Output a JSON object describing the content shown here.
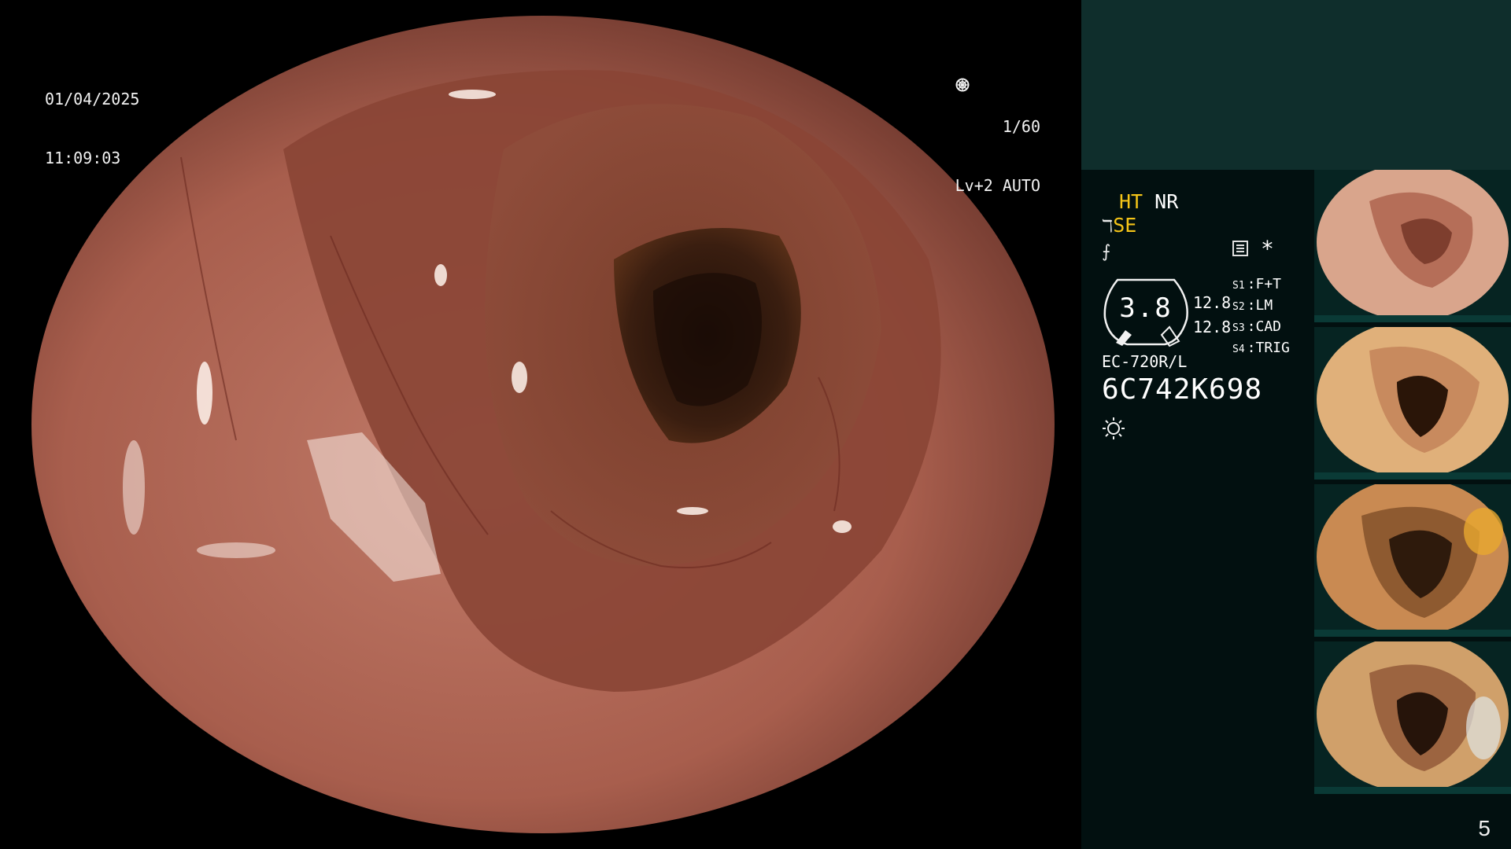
{
  "osd": {
    "date": "01/04/2025",
    "time": "11:09:03",
    "shutter": "1/60",
    "level": "Lv+2 AUTO"
  },
  "status": {
    "ht": "HT",
    "nr": "NR",
    "se": "SE",
    "zoom": "3.8",
    "enh_a": "12.8",
    "enh_b": "12.8",
    "modes": [
      {
        "key": "S1",
        "label": "F+T"
      },
      {
        "key": "S2",
        "label": "LM"
      },
      {
        "key": "S3",
        "label": "CAD"
      },
      {
        "key": "S4",
        "label": "TRIG"
      }
    ],
    "model": "EC-720R/L",
    "serial": "6C742K698"
  },
  "page": {
    "number": "5"
  },
  "icons": [
    "shutter-icon",
    "iris-icon",
    "freeze-icon",
    "signal-icon",
    "histogram-icon",
    "light-icon"
  ],
  "colors": {
    "panel_bg": "#021010",
    "panel_top": "#0f2e2c",
    "highlight": "#f5c518",
    "mucosa": "#a8574a"
  }
}
